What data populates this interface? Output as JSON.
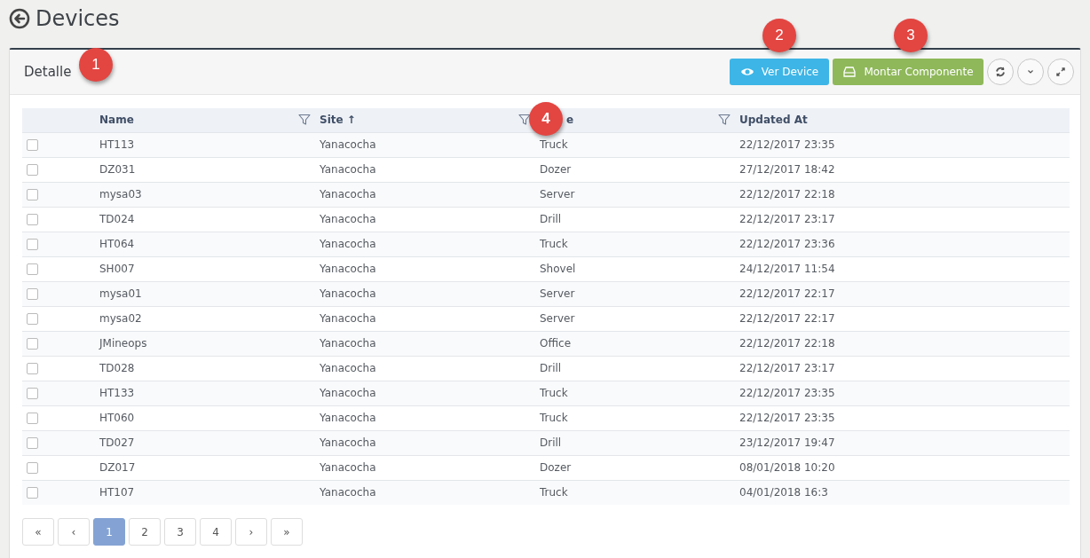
{
  "page": {
    "title": "Devices"
  },
  "panel": {
    "title": "Detalle",
    "callout": "1",
    "buttons": [
      {
        "kind": "view",
        "label": "Ver Device",
        "callout": "2"
      },
      {
        "kind": "mount",
        "label": "Montar Componente",
        "callout": "3"
      }
    ]
  },
  "table": {
    "columns": [
      {
        "label": "Name",
        "filter": true
      },
      {
        "label": "Site ↑",
        "filter": true
      },
      {
        "label": "e",
        "filter": true,
        "callout": "4"
      },
      {
        "label": "Updated At",
        "filter": false
      }
    ],
    "rows": [
      {
        "checked": false,
        "cells": [
          "HT113",
          "Yanacocha",
          "Truck",
          "22/12/2017 23:35"
        ]
      },
      {
        "checked": false,
        "cells": [
          "DZ031",
          "Yanacocha",
          "Dozer",
          "27/12/2017 18:42"
        ]
      },
      {
        "checked": false,
        "cells": [
          "mysa03",
          "Yanacocha",
          "Server",
          "22/12/2017 22:18"
        ]
      },
      {
        "checked": false,
        "cells": [
          "TD024",
          "Yanacocha",
          "Drill",
          "22/12/2017 23:17"
        ]
      },
      {
        "checked": false,
        "cells": [
          "HT064",
          "Yanacocha",
          "Truck",
          "22/12/2017 23:36"
        ]
      },
      {
        "checked": false,
        "cells": [
          "SH007",
          "Yanacocha",
          "Shovel",
          "24/12/2017 11:54"
        ]
      },
      {
        "checked": false,
        "cells": [
          "mysa01",
          "Yanacocha",
          "Server",
          "22/12/2017 22:17"
        ]
      },
      {
        "checked": false,
        "cells": [
          "mysa02",
          "Yanacocha",
          "Server",
          "22/12/2017 22:17"
        ]
      },
      {
        "checked": false,
        "cells": [
          "JMineops",
          "Yanacocha",
          "Office",
          "22/12/2017 22:18"
        ]
      },
      {
        "checked": false,
        "cells": [
          "TD028",
          "Yanacocha",
          "Drill",
          "22/12/2017 23:17"
        ]
      },
      {
        "checked": false,
        "cells": [
          "HT133",
          "Yanacocha",
          "Truck",
          "22/12/2017 23:35"
        ]
      },
      {
        "checked": false,
        "cells": [
          "HT060",
          "Yanacocha",
          "Truck",
          "22/12/2017 23:35"
        ]
      },
      {
        "checked": false,
        "cells": [
          "TD027",
          "Yanacocha",
          "Drill",
          "23/12/2017 19:47"
        ]
      },
      {
        "checked": false,
        "cells": [
          "DZ017",
          "Yanacocha",
          "Dozer",
          "08/01/2018 10:20"
        ]
      },
      {
        "checked": false,
        "cells": [
          "HT107",
          "Yanacocha",
          "Truck",
          "04/01/2018 16:3"
        ]
      }
    ]
  },
  "pagination": [
    {
      "label": "«",
      "selected": false
    },
    {
      "label": "‹",
      "selected": false
    },
    {
      "label": "1",
      "selected": true
    },
    {
      "label": "2",
      "selected": false
    },
    {
      "label": "3",
      "selected": false
    },
    {
      "label": "4",
      "selected": false
    },
    {
      "label": "›",
      "selected": false
    },
    {
      "label": "»",
      "selected": false
    }
  ]
}
